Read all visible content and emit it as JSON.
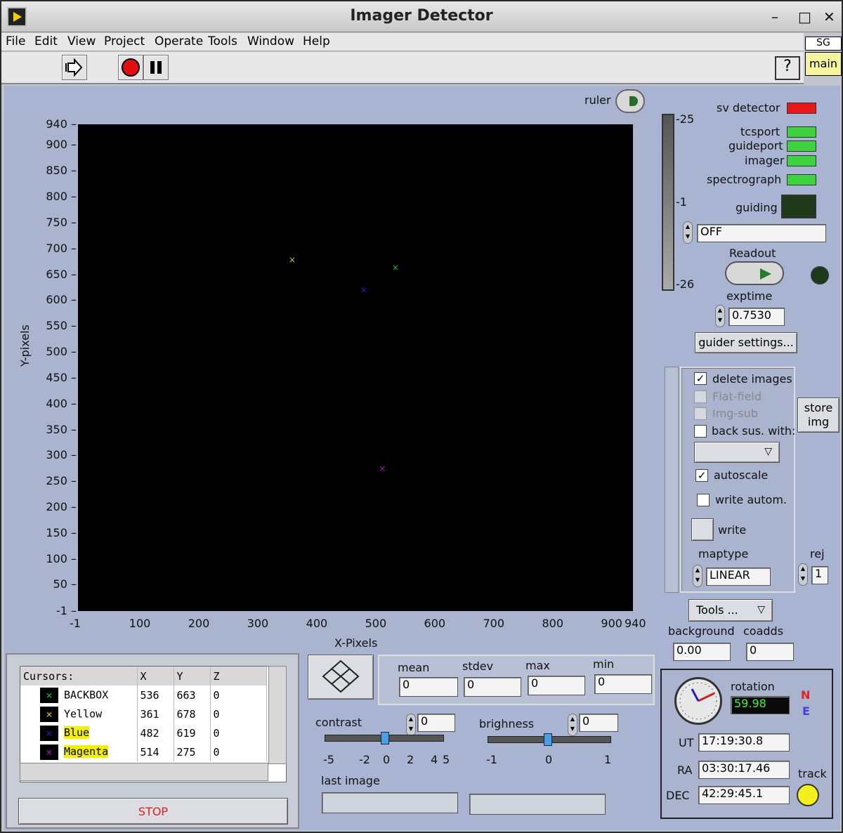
{
  "window": {
    "title": "Imager Detector",
    "minimize": "–",
    "maximize": "□",
    "close": "✕"
  },
  "menu": [
    "File",
    "Edit",
    "View",
    "Project",
    "Operate",
    "Tools",
    "Window",
    "Help"
  ],
  "toolbar": {
    "run_icon": "run-arrow-icon",
    "stop_icon": "abort-icon",
    "pause_icon": "pause-icon",
    "help": "?"
  },
  "context": {
    "sg": "SG",
    "main": "main"
  },
  "plot": {
    "ruler_label": "ruler",
    "xlabel": "X-Pixels",
    "ylabel": "Y-pixels",
    "yticks": [
      "940",
      "900",
      "850",
      "800",
      "750",
      "700",
      "650",
      "600",
      "550",
      "500",
      "450",
      "400",
      "350",
      "300",
      "250",
      "200",
      "150",
      "100",
      "50",
      "-1"
    ],
    "xticks": [
      "-1",
      "100",
      "200",
      "300",
      "400",
      "500",
      "600",
      "700",
      "800",
      "900",
      "940"
    ],
    "markers": [
      {
        "name": "BACKBOX",
        "x": 536,
        "y": 663,
        "color": "#10c010"
      },
      {
        "name": "Yellow",
        "x": 361,
        "y": 678,
        "color": "#d0c010"
      },
      {
        "name": "Blue",
        "x": 482,
        "y": 619,
        "color": "#2020c0"
      },
      {
        "name": "Magenta",
        "x": 514,
        "y": 275,
        "color": "#a010c0"
      }
    ]
  },
  "colorbar": {
    "top": "-25",
    "mid": "-1",
    "bottom": "-26"
  },
  "status": {
    "sv_detector": "sv detector",
    "tcsport": "tcsport",
    "guideport": "guideport",
    "imager": "imager",
    "spectrograph": "spectrograph",
    "guiding": "guiding",
    "guiding_mode": "OFF",
    "readout": "Readout",
    "exptime_label": "exptime",
    "exptime": "0.7530",
    "guider_settings": "guider settings..."
  },
  "options": {
    "delete_images": "delete images",
    "flat_field": "Flat-field",
    "img_sub": "Img-sub",
    "back_sus": "back sus. with:",
    "autoscale": "autoscale",
    "write_autom": "write autom.",
    "write": "write",
    "maptype_label": "maptype",
    "maptype": "LINEAR",
    "rej_label": "rej",
    "rej": "1",
    "store_img": "store img",
    "tools": "Tools ...",
    "check": "✓"
  },
  "bg": {
    "background_label": "background",
    "background": "0.00",
    "coadds_label": "coadds",
    "coadds": "0"
  },
  "cursors": {
    "header": [
      "Cursors:",
      "X",
      "Y",
      "Z"
    ],
    "rows": [
      {
        "name": "BACKBOX",
        "x": "536",
        "y": "663",
        "z": "0",
        "color": "#10c010",
        "highlight": false
      },
      {
        "name": "Yellow",
        "x": "361",
        "y": "678",
        "z": "0",
        "color": "#d0c010",
        "highlight": false
      },
      {
        "name": "Blue",
        "x": "482",
        "y": "619",
        "z": "0",
        "color": "#2020c0",
        "highlight": true
      },
      {
        "name": "Magenta",
        "x": "514",
        "y": "275",
        "z": "0",
        "color": "#a010c0",
        "highlight": true
      }
    ],
    "mark": "×"
  },
  "stop": "STOP",
  "stats": {
    "mean_label": "mean",
    "mean": "0",
    "stdev_label": "stdev",
    "stdev": "0",
    "max_label": "max",
    "max": "0",
    "min_label": "min",
    "min": "0"
  },
  "contrast": {
    "label": "contrast",
    "value": "0",
    "ticks": [
      "-5",
      "-2",
      "0",
      "2",
      "4",
      "5"
    ]
  },
  "brighness": {
    "label": "brighness",
    "value": "0",
    "ticks": [
      "-1",
      "0",
      "1"
    ]
  },
  "last_image": {
    "label": "last image",
    "value": "",
    "value2": ""
  },
  "telescope": {
    "rotation_label": "rotation",
    "rotation": "59.98",
    "north": "N",
    "east": "E",
    "ut_label": "UT",
    "ut": "17:19:30.8",
    "ra_label": "RA",
    "ra": "03:30:17.46",
    "dec_label": "DEC",
    "dec": "42:29:45.1",
    "track": "track"
  }
}
